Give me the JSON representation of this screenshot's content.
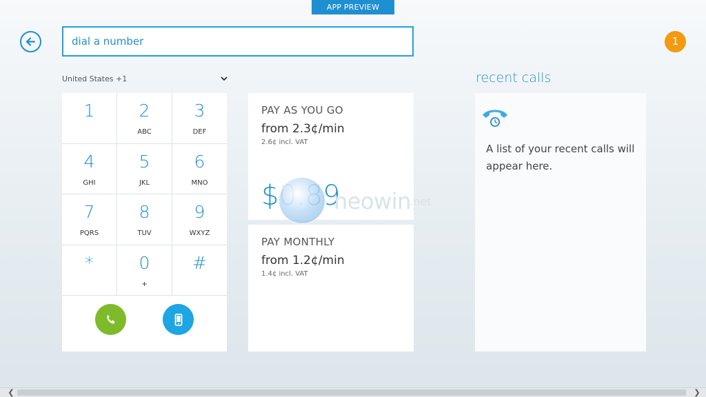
{
  "banner": {
    "label": "APP PREVIEW"
  },
  "header": {
    "dial_placeholder": "dial a number",
    "notification_count": "1"
  },
  "country": {
    "selected": "United States +1"
  },
  "dialpad": {
    "keys": [
      {
        "digit": "1",
        "letters": ""
      },
      {
        "digit": "2",
        "letters": "ABC"
      },
      {
        "digit": "3",
        "letters": "DEF"
      },
      {
        "digit": "4",
        "letters": "GHI"
      },
      {
        "digit": "5",
        "letters": "JKL"
      },
      {
        "digit": "6",
        "letters": "MNO"
      },
      {
        "digit": "7",
        "letters": "PQRS"
      },
      {
        "digit": "8",
        "letters": "TUV"
      },
      {
        "digit": "9",
        "letters": "WXYZ"
      },
      {
        "digit": "*",
        "letters": ""
      },
      {
        "digit": "0",
        "letters": "+"
      },
      {
        "digit": "#",
        "letters": ""
      }
    ],
    "call_icon": "phone-icon",
    "mobile_icon": "mobile-phone-icon"
  },
  "plans": {
    "go": {
      "heading": "PAY AS YOU GO",
      "rate": "from 2.3¢/min",
      "vat": "2.6¢ incl. VAT",
      "price": "$0.89"
    },
    "monthly": {
      "heading": "PAY MONTHLY",
      "rate": "from 1.2¢/min",
      "vat": "1.4¢ incl. VAT"
    }
  },
  "watermark": {
    "word": "neowin",
    "tld": ".net"
  },
  "recent": {
    "title": "recent calls",
    "message": "A list of your recent calls will appear here.",
    "icon": "recent-calls-icon"
  },
  "colors": {
    "accent": "#1e8fd0",
    "call_green": "#7dbb2a",
    "notification_orange": "#f39a10"
  }
}
